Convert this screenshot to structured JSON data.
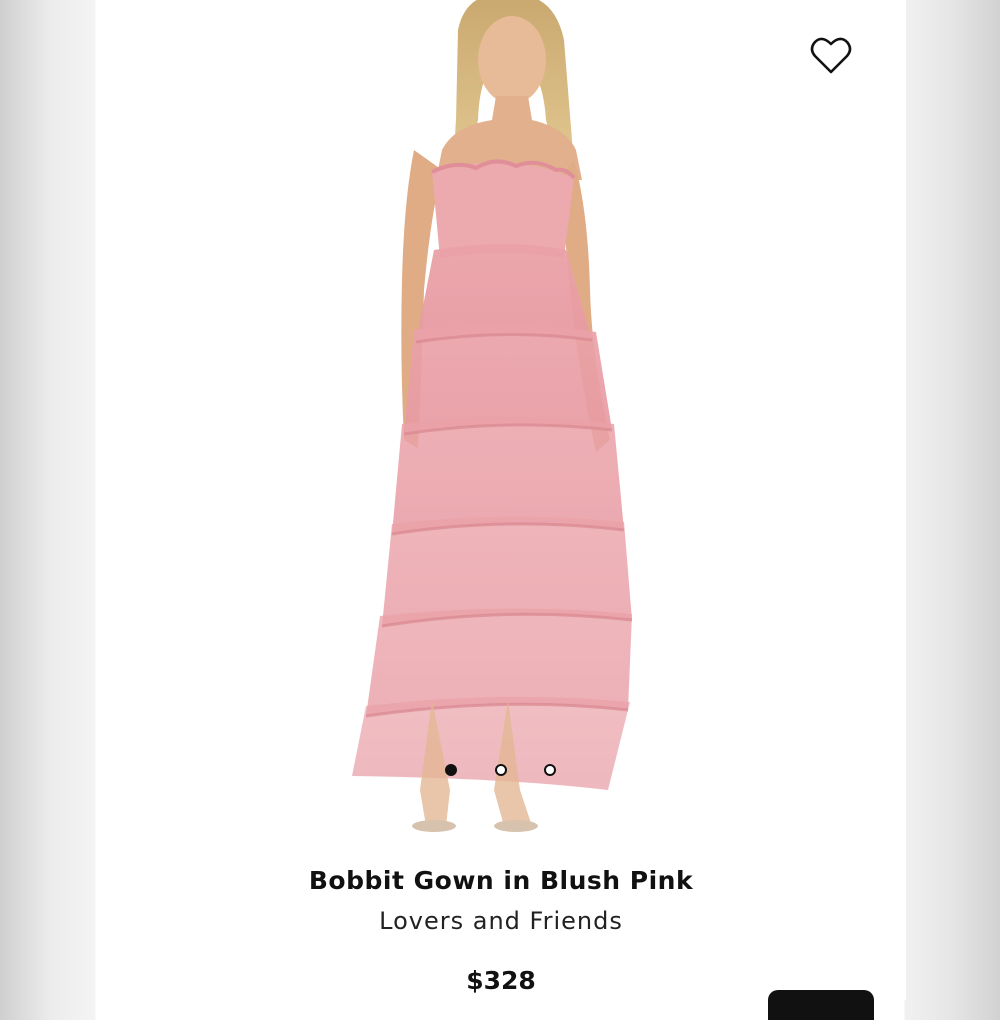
{
  "product": {
    "title": "Bobbit Gown in Blush Pink",
    "brand": "Lovers and Friends",
    "price": "$328"
  },
  "gallery": {
    "image_count": 3,
    "active_index": 0,
    "image_alt": "Model wearing a blush pink tiered tulle strapless gown"
  },
  "icons": {
    "favorite": "heart-outline-icon"
  },
  "colors": {
    "accent": "#111111",
    "dress": "#e8a0a6",
    "background": "#ffffff"
  }
}
